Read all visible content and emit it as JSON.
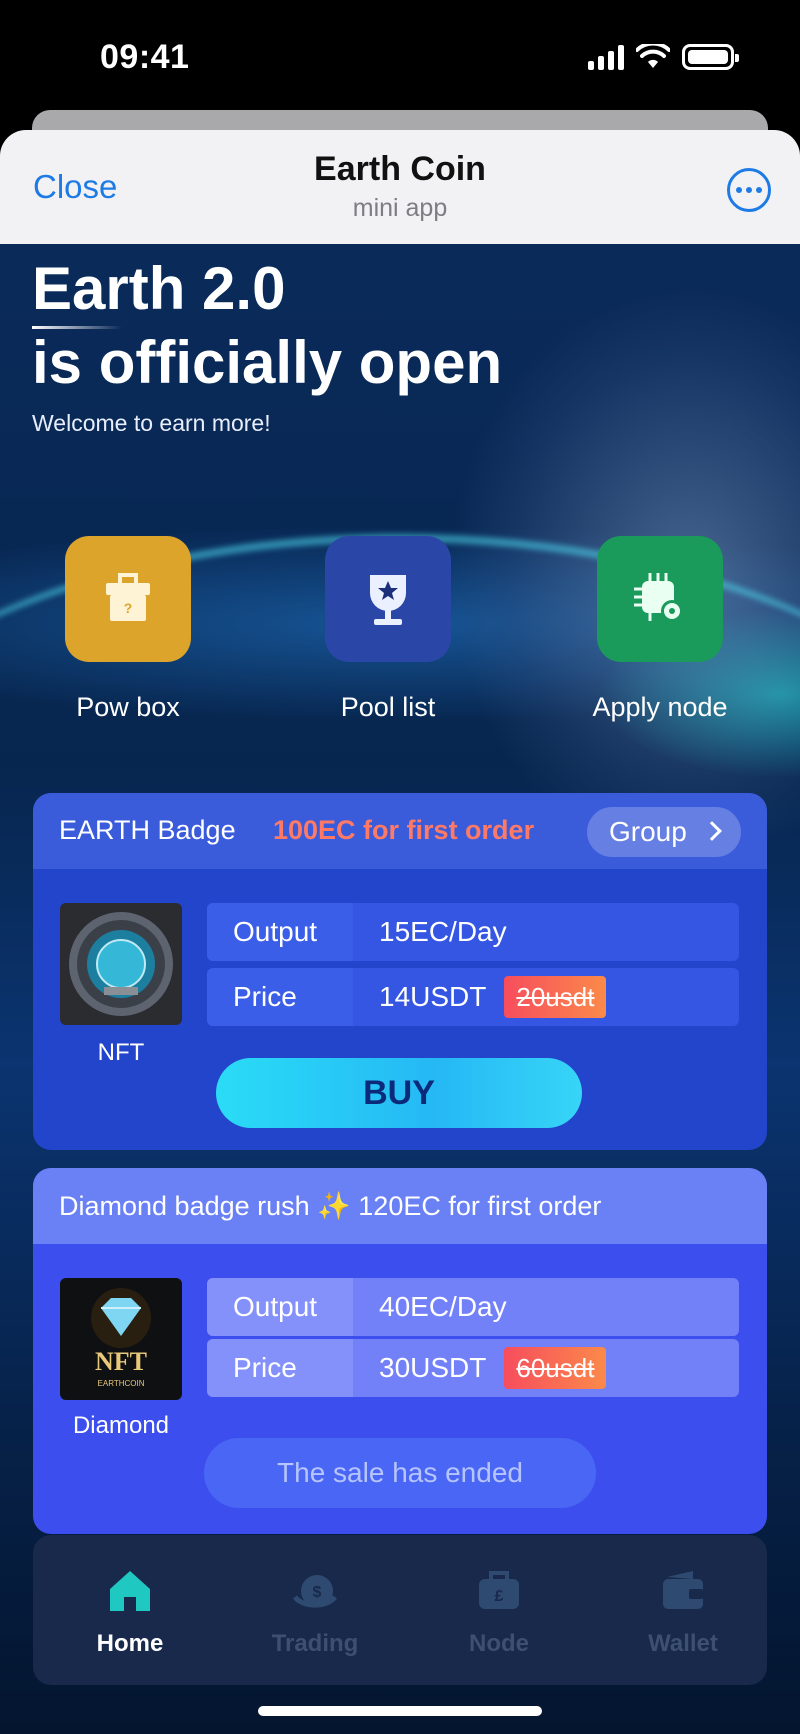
{
  "status_bar": {
    "time": "09:41"
  },
  "header": {
    "close_label": "Close",
    "title": "Earth Coin",
    "subtitle": "mini app"
  },
  "hero": {
    "title_line1": "Earth 2.0",
    "title_line2": "is officially open",
    "subtitle": "Welcome to earn more!"
  },
  "actions": [
    {
      "label": "Pow box",
      "icon": "gift-box-icon",
      "color": "#dca42a"
    },
    {
      "label": "Pool list",
      "icon": "trophy-icon",
      "color": "#2a47a8"
    },
    {
      "label": "Apply node",
      "icon": "chip-gear-icon",
      "color": "#1a9a5b"
    }
  ],
  "cards": [
    {
      "title": "EARTH Badge",
      "promo": "100EC for first order",
      "group_label": "Group",
      "nft_label": "NFT",
      "output_key": "Output",
      "output_value": "15EC/Day",
      "price_key": "Price",
      "price_value": "14USDT",
      "old_price": "20usdt",
      "action_label": "BUY"
    },
    {
      "title": "Diamond badge rush ✨ 120EC for first order",
      "nft_label": "Diamond",
      "output_key": "Output",
      "output_value": "40EC/Day",
      "price_key": "Price",
      "price_value": "30USDT",
      "old_price": "60usdt",
      "action_label": "The sale has ended"
    }
  ],
  "tabs": [
    {
      "label": "Home",
      "icon": "home-icon",
      "active": true
    },
    {
      "label": "Trading",
      "icon": "trading-icon",
      "active": false
    },
    {
      "label": "Node",
      "icon": "briefcase-icon",
      "active": false
    },
    {
      "label": "Wallet",
      "icon": "wallet-icon",
      "active": false
    }
  ],
  "colors": {
    "accent_blue": "#1e7be6",
    "promo_red": "#ff7a66",
    "active_tab": "#1fc8c0",
    "inactive_tab": "#2f4a70"
  }
}
